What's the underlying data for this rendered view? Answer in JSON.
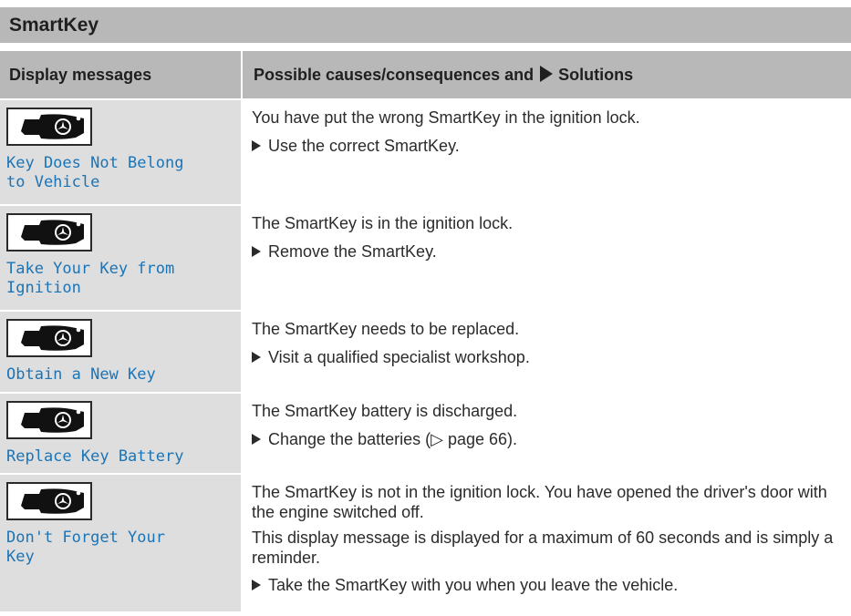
{
  "section_title": "SmartKey",
  "table": {
    "header_left": "Display messages",
    "header_right_prefix": "Possible causes/consequences and",
    "header_right_suffix": "Solutions",
    "rows": [
      {
        "display_message": "Key Does Not Belong\nto Vehicle",
        "icon": "smartkey-icon",
        "lines": [
          "You have put the wrong SmartKey in the ignition lock."
        ],
        "step": "Use the correct SmartKey."
      },
      {
        "display_message": "Take Your Key from\nIgnition",
        "icon": "smartkey-icon",
        "lines": [
          "The SmartKey is in the ignition lock."
        ],
        "step": "Remove the SmartKey."
      },
      {
        "display_message": "Obtain a New Key",
        "icon": "smartkey-icon",
        "lines": [
          "The SmartKey needs to be replaced."
        ],
        "step": "Visit a qualified specialist workshop."
      },
      {
        "display_message": "Replace Key Battery",
        "icon": "smartkey-icon",
        "lines": [
          "The SmartKey battery is discharged."
        ],
        "step": "Change the batteries (▷ page 66)."
      },
      {
        "display_message": "Don't Forget Your\nKey",
        "icon": "smartkey-icon",
        "lines": [
          "The SmartKey is not in the ignition lock. You have opened the driver's door with the engine switched off.",
          "This display message is displayed for a maximum of 60 seconds and is simply a reminder."
        ],
        "step": "Take the SmartKey with you when you leave the vehicle."
      }
    ]
  }
}
